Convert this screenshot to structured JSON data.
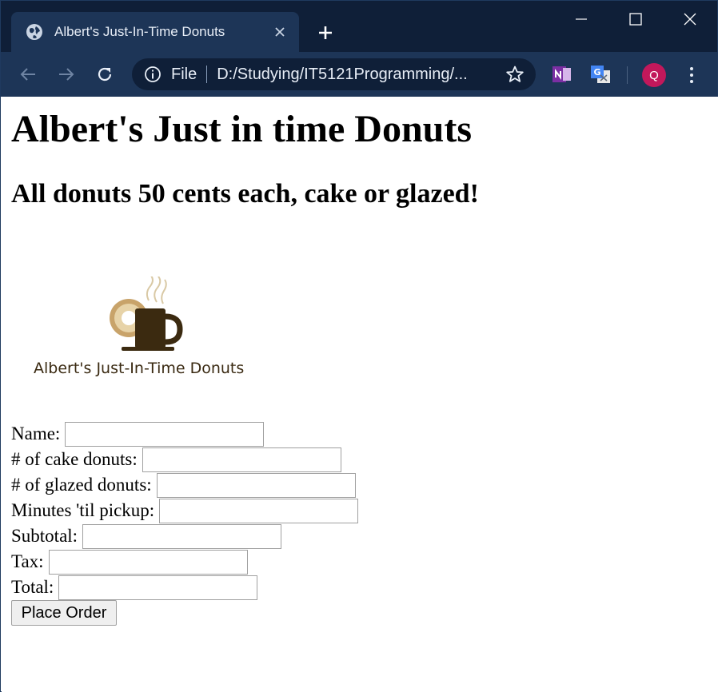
{
  "browser": {
    "tab_title": "Albert's Just-In-Time Donuts",
    "url_scheme": "File",
    "url": "D:/Studying/IT5121Programming/...",
    "profile_initial": "Q",
    "icons": [
      "globe-icon",
      "close-icon",
      "plus-icon",
      "minimize-icon",
      "maximize-icon",
      "close-window-icon",
      "back-icon",
      "forward-icon",
      "reload-icon",
      "info-icon",
      "star-icon",
      "onenote-icon",
      "translate-icon",
      "menu-icon"
    ]
  },
  "page": {
    "heading": "Albert's Just in time Donuts",
    "subheading": "All donuts 50 cents each, cake or glazed!",
    "logo_text": "Albert's Just-In-Time Donuts",
    "form": {
      "fields": [
        {
          "label": "Name:",
          "value": ""
        },
        {
          "label": "# of cake donuts:",
          "value": ""
        },
        {
          "label": "# of glazed donuts:",
          "value": ""
        },
        {
          "label": "Minutes 'til pickup:",
          "value": ""
        },
        {
          "label": "Subtotal:",
          "value": ""
        },
        {
          "label": "Tax:",
          "value": ""
        },
        {
          "label": "Total:",
          "value": ""
        }
      ],
      "submit_label": "Place Order"
    }
  },
  "colors": {
    "tabstrip": "#0f1f38",
    "toolbar": "#1d3557",
    "avatar": "#c2185b",
    "logo_brown": "#3a2a12"
  }
}
